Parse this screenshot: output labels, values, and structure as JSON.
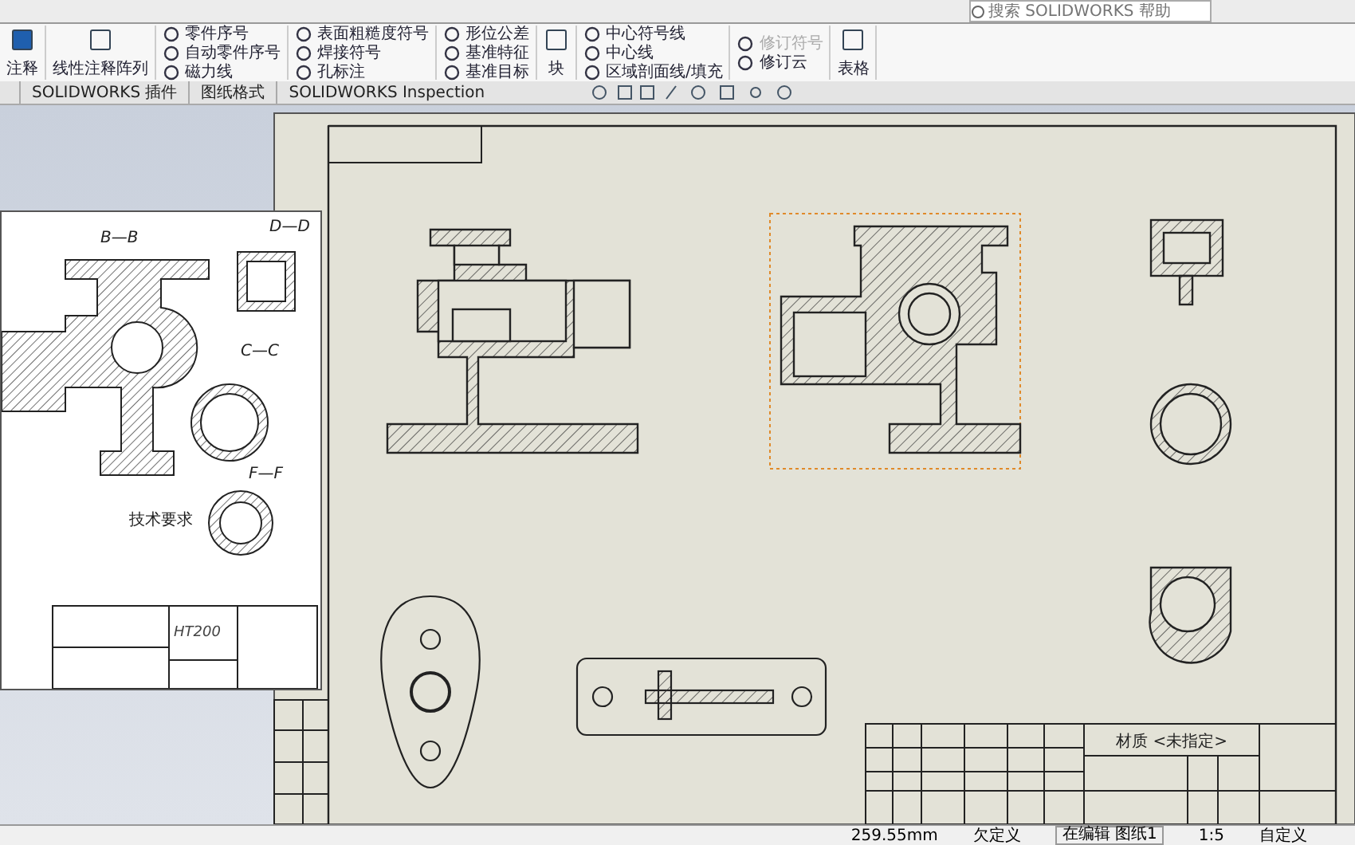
{
  "search": {
    "placeholder": "搜索 SOLIDWORKS 帮助"
  },
  "ribbon": {
    "groups": [
      {
        "kind": "big",
        "items": [
          {
            "label": "注释",
            "disabled": false
          }
        ]
      },
      {
        "kind": "big",
        "items": [
          {
            "label": "线性注释阵列",
            "disabled": false
          }
        ]
      },
      {
        "kind": "list",
        "items": [
          {
            "label": "零件序号",
            "disabled": false
          },
          {
            "label": "自动零件序号",
            "disabled": false
          },
          {
            "label": "磁力线",
            "disabled": false
          }
        ]
      },
      {
        "kind": "list",
        "items": [
          {
            "label": "表面粗糙度符号",
            "disabled": false
          },
          {
            "label": "焊接符号",
            "disabled": false
          },
          {
            "label": "孔标注",
            "disabled": false
          }
        ]
      },
      {
        "kind": "list",
        "items": [
          {
            "label": "形位公差",
            "disabled": false
          },
          {
            "label": "基准特征",
            "disabled": false
          },
          {
            "label": "基准目标",
            "disabled": false
          }
        ]
      },
      {
        "kind": "big",
        "items": [
          {
            "label": "块",
            "disabled": false
          }
        ]
      },
      {
        "kind": "list",
        "items": [
          {
            "label": "中心符号线",
            "disabled": false
          },
          {
            "label": "中心线",
            "disabled": false
          },
          {
            "label": "区域剖面线/填充",
            "disabled": false
          }
        ]
      },
      {
        "kind": "list",
        "items": [
          {
            "label": "修订符号",
            "disabled": true
          },
          {
            "label": "修订云",
            "disabled": false
          }
        ]
      },
      {
        "kind": "big",
        "items": [
          {
            "label": "表格",
            "disabled": false
          }
        ]
      }
    ]
  },
  "tabs": [
    {
      "label": "SOLIDWORKS 插件"
    },
    {
      "label": "图纸格式"
    },
    {
      "label": "SOLIDWORKS Inspection"
    }
  ],
  "inset_drawing": {
    "section_labels": [
      "B—B",
      "D—D",
      "C—C",
      "F—F"
    ],
    "notes_title": "技术要求",
    "material": "HT200"
  },
  "sheet": {
    "title_block": {
      "material": "材质 <未指定>"
    }
  },
  "status_bar": {
    "length": "259.55mm",
    "state": "欠定义",
    "mode": "在编辑 图纸1",
    "scale": "1:5",
    "units": "自定义"
  }
}
